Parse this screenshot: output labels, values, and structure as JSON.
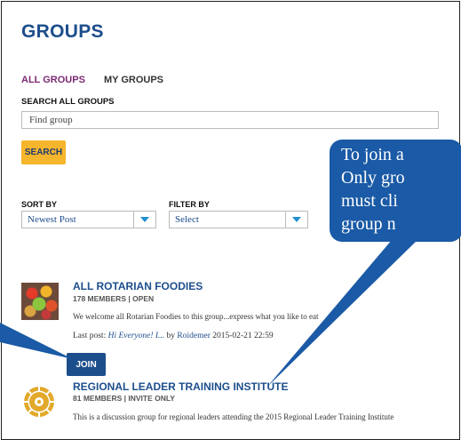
{
  "page": {
    "title": "GROUPS"
  },
  "tabs": {
    "all": "ALL GROUPS",
    "my": "MY GROUPS"
  },
  "search": {
    "label": "SEARCH ALL GROUPS",
    "placeholder": "Find group",
    "button": "SEARCH"
  },
  "sort": {
    "label": "SORT BY",
    "value": "Newest Post"
  },
  "filter": {
    "label": "FILTER BY",
    "value": "Select"
  },
  "groups": [
    {
      "name": "ALL ROTARIAN FOODIES",
      "meta": "178 MEMBERS | OPEN",
      "description": "We welcome all Rotarian Foodies to this group...express what you like to eat",
      "lastpost_prefix": "Last post:",
      "lastpost_link": "Hi Everyone! I...",
      "lastpost_by": "by",
      "lastpost_user": "Roidemer",
      "lastpost_time": "2015-02-21 22:59",
      "join": "JOIN",
      "thumb_icon": "food-photo"
    },
    {
      "name": "REGIONAL LEADER TRAINING INSTITUTE",
      "meta": "81 MEMBERS | INVITE ONLY",
      "description": "This is a discussion group for regional leaders attending the 2015 Regional Leader Training Institute",
      "thumb_icon": "rotary-wheel-logo"
    }
  ],
  "callout": {
    "lines": [
      "To join a",
      "Only gro",
      "must cli",
      "group n"
    ],
    "color": "#1a5aa6"
  },
  "colors": {
    "brand": "#1d4e8c",
    "accent": "#f5b52c",
    "tab_active": "#7a2a73"
  }
}
